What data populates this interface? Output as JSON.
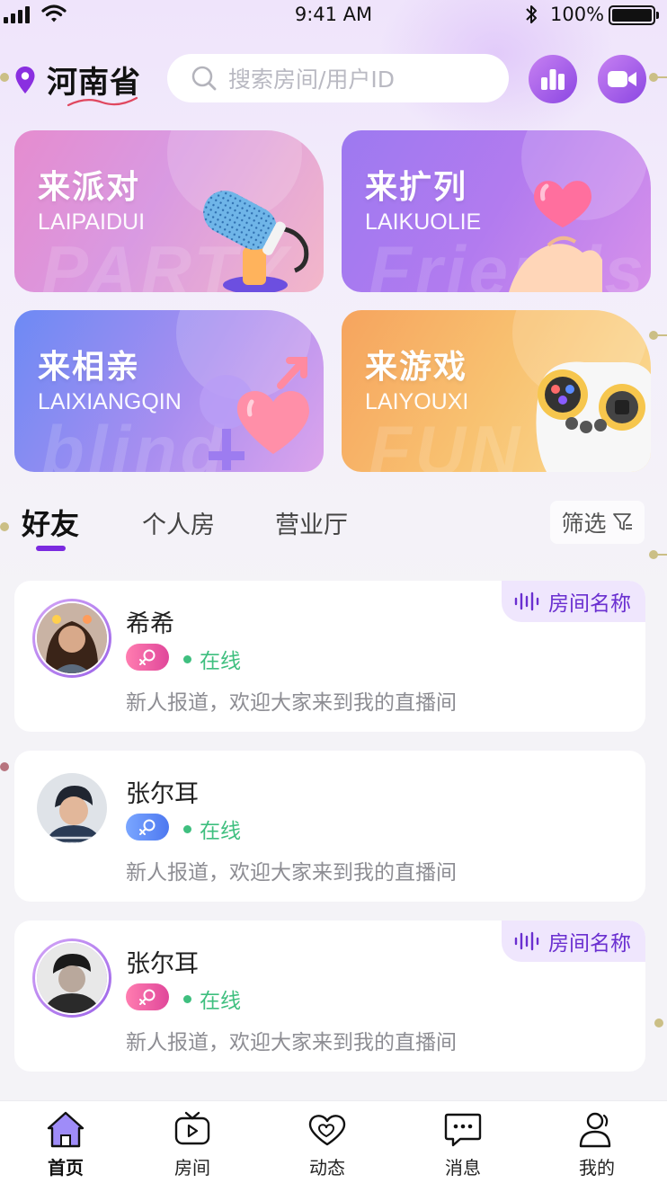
{
  "status_bar": {
    "time": "9:41 AM",
    "battery": "100%"
  },
  "header": {
    "location": "河南省",
    "search_placeholder": "搜索房间/用户ID"
  },
  "categories": [
    {
      "title": "来派对",
      "subtitle": "LAIPAIDUI",
      "watermark": "PARTY"
    },
    {
      "title": "来扩列",
      "subtitle": "LAIKUOLIE",
      "watermark": "Friends"
    },
    {
      "title": "来相亲",
      "subtitle": "LAIXIANGQIN",
      "watermark": "blind"
    },
    {
      "title": "来游戏",
      "subtitle": "LAIYOUXI",
      "watermark": "FUN"
    }
  ],
  "tabs": [
    {
      "label": "好友",
      "active": true
    },
    {
      "label": "个人房",
      "active": false
    },
    {
      "label": "营业厅",
      "active": false
    }
  ],
  "filter": {
    "label": "筛选"
  },
  "users": [
    {
      "name": "希希",
      "gender": "female",
      "status": "在线",
      "bio": "新人报道，欢迎大家来到我的直播间",
      "room_tag": "房间名称"
    },
    {
      "name": "张尔耳",
      "gender": "male",
      "status": "在线",
      "bio": "新人报道，欢迎大家来到我的直播间",
      "room_tag": ""
    },
    {
      "name": "张尔耳",
      "gender": "female",
      "status": "在线",
      "bio": "新人报道，欢迎大家来到我的直播间",
      "room_tag": "房间名称"
    }
  ],
  "bottom_nav": [
    {
      "label": "首页",
      "icon": "home-icon",
      "active": true
    },
    {
      "label": "房间",
      "icon": "tv-icon",
      "active": false
    },
    {
      "label": "动态",
      "icon": "heart-chat-icon",
      "active": false
    },
    {
      "label": "消息",
      "icon": "message-icon",
      "active": false
    },
    {
      "label": "我的",
      "icon": "user-icon",
      "active": false
    }
  ],
  "colors": {
    "accent": "#7b2ae0",
    "online": "#3fbf7f",
    "female": "#e0479a",
    "male": "#4d78f0",
    "room_tag_bg": "#efe6fd"
  }
}
